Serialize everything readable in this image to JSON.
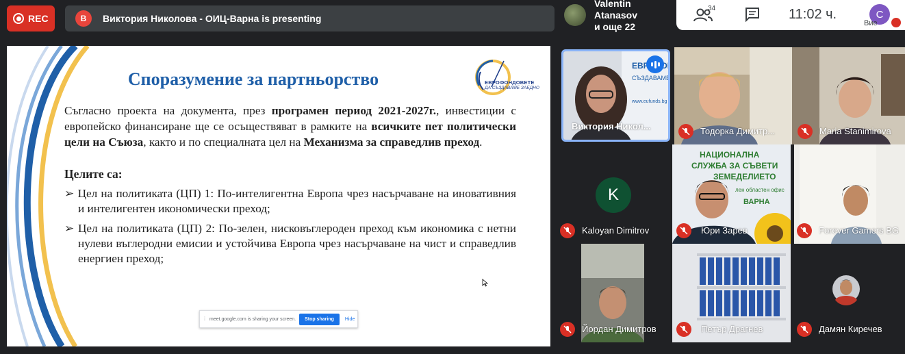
{
  "recording": {
    "label": "REC"
  },
  "presenting": {
    "avatar_letter": "В",
    "text": "Виктория Николова - ОИЦ-Варна is presenting"
  },
  "pinned": {
    "line1": "Valentin Atanasov",
    "line2": "и още 22"
  },
  "controls": {
    "people_count": "34",
    "time": "11:02 ч.",
    "self_avatar": "C",
    "self_label": "Вие"
  },
  "slide": {
    "title": "Споразумение за партньорство",
    "logo_line1": "ЕВРОФОНДОВЕТЕ",
    "logo_line2": "ДА СЪЗДАВАМЕ ЗАЕДНО",
    "intro_1": "Съгласно проекта на документа, през ",
    "intro_b1": "програмен период 2021-2027г.",
    "intro_2": ", инвестиции с европейско финансиране ще се осъществяват в рамките на ",
    "intro_b2": "всичките пет политически цели на Съюза",
    "intro_3": ", както и по специалната цел на ",
    "intro_b3": "Механизма за справедлив преход",
    "intro_4": ".",
    "goals_heading": "Целите са:",
    "goal1": "Цел на политиката (ЦП) 1: По-интелигентна Европа чрез насърчаване на иновативния и интелигентен икономически преход;",
    "goal2": "Цел на политиката (ЦП) 2: По-зелен, нисковъглероден преход към икономика с нетни нулеви въглеродни емисии и устойчива Европа чрез насърчаване на чист и справедлив енергиен преход;",
    "bullet": "➢"
  },
  "share_bar": {
    "message": "meet.google.com is sharing your screen.",
    "stop_label": "Stop sharing",
    "hide_label": "Hide"
  },
  "participants": [
    {
      "name": "Виктория Никол...",
      "speaking": true
    },
    {
      "name": "Тодорка Димитр...",
      "muted": true
    },
    {
      "name": "Maria Stanimirova",
      "muted": true
    },
    {
      "name": "Kaloyan Dimitrov",
      "muted": true,
      "avatar_letter": "K"
    },
    {
      "name": "Юри Зарев",
      "muted": true
    },
    {
      "name": "Forever Gamers BG",
      "muted": true
    },
    {
      "name": "Йордан Димитров",
      "muted": true
    },
    {
      "name": "Петър Драгнев",
      "muted": true
    },
    {
      "name": "Дамян Киречев",
      "muted": true
    }
  ],
  "tile_texts": {
    "evroponds": "ЕВРОПОН",
    "sazdavame": "СЪЗДАВАМЕ",
    "eufunds": "www.eufunds.bg",
    "nsss_1": "НАЦИОНАЛНА",
    "nsss_2": "СЛУЖБА ЗА СЪВЕТИ",
    "nsss_3": "ЗЕМЕДЕЛИЕТО",
    "nsss_4": "лен областен офис",
    "nsss_5": "ВАРНА"
  },
  "colors": {
    "rec": "#d93025",
    "title_blue": "#1f5fa8",
    "tile_bg": "#3c4043",
    "page_bg": "#202124",
    "active": "#8ab4f8",
    "mute": "#d93025"
  }
}
